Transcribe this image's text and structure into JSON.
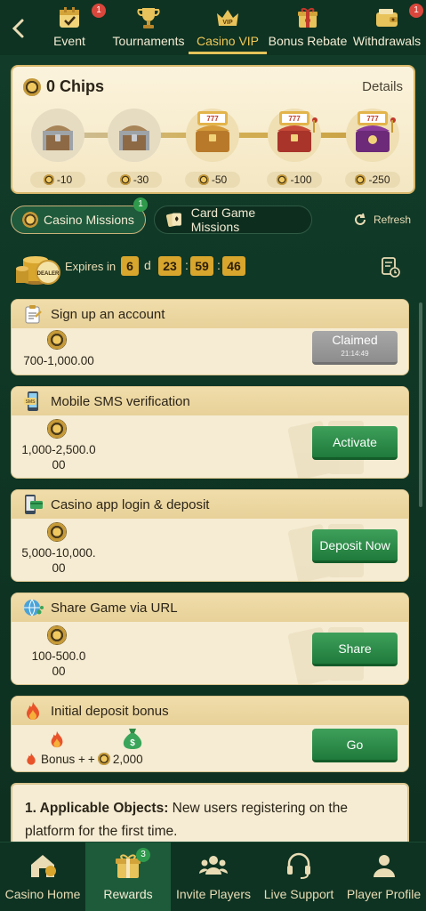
{
  "nav": {
    "back_glyph": "‹",
    "tabs": [
      {
        "label": "Event",
        "icon": "calendar-check-icon",
        "badge": "1"
      },
      {
        "label": "Tournaments",
        "icon": "trophy-icon",
        "badge": ""
      },
      {
        "label": "Casino VIP",
        "icon": "vip-crown-icon",
        "badge": "",
        "active": true
      },
      {
        "label": "Bonus Rebate",
        "icon": "gift-box-icon",
        "badge": ""
      },
      {
        "label": "Withdrawals",
        "icon": "wallet-icon",
        "badge": "1"
      }
    ]
  },
  "chips": {
    "title": "0 Chips",
    "details_label": "Details",
    "milestones": [
      "-10",
      "-30",
      "-50",
      "-100",
      "-250"
    ]
  },
  "missions_tabs": {
    "casino": "Casino Missions",
    "casino_badge": "1",
    "card": "Card Game Missions",
    "refresh": "Refresh"
  },
  "expires": {
    "label": "Expires in",
    "days": "6",
    "d": "d",
    "hours": "23",
    "minutes": "59",
    "seconds": "46",
    "sep": ":",
    "dealer": "DEALER"
  },
  "missions": [
    {
      "title": "Sign up an account",
      "icon": "clipboard-icon",
      "reward": "700-1,000.00",
      "button": "Claimed",
      "button_sub": "21:14:49",
      "state": "claimed"
    },
    {
      "title": "Mobile SMS verification",
      "icon": "phone-sms-icon",
      "reward_l1": "1,000-2,500.0",
      "reward_l2": "00",
      "button": "Activate"
    },
    {
      "title": "Casino app login & deposit",
      "icon": "phone-deposit-icon",
      "reward_l1": "5,000-10,000.",
      "reward_l2": "00",
      "button": "Deposit Now"
    },
    {
      "title": "Share Game via URL",
      "icon": "share-globe-icon",
      "reward_l1": "100-500.0",
      "reward_l2": "00",
      "button": "Share"
    },
    {
      "title": "Initial deposit bonus",
      "icon": "fire-icon",
      "reward_bonus": "Bonus + ",
      "reward_plus": "+",
      "reward_chips": "2,000",
      "button": "Go"
    }
  ],
  "rules": {
    "heading": "1. Applicable Objects:",
    "text": " New users registering on the platform for the first time."
  },
  "bottom": [
    {
      "label": "Casino Home",
      "icon": "casino-home-icon"
    },
    {
      "label": "Rewards",
      "icon": "gift-rewards-icon",
      "badge": "3",
      "active": true
    },
    {
      "label": "Invite Players",
      "icon": "people-icon"
    },
    {
      "label": "Live Support",
      "icon": "headset-icon"
    },
    {
      "label": "Player Profile",
      "icon": "user-icon"
    }
  ],
  "colors": {
    "background": "#0f3524",
    "accent_gold": "#e5c25a",
    "card_bg": "#f5ecd3",
    "button_green": "#2a8c48",
    "badge_red": "#d9473c"
  }
}
